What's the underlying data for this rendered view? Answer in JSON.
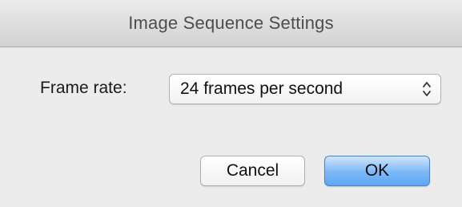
{
  "window": {
    "title": "Image Sequence Settings"
  },
  "frame_rate": {
    "label": "Frame rate:",
    "selected_value": "24 frames per second",
    "icon": "updown-chevron-icon"
  },
  "buttons": {
    "cancel_label": "Cancel",
    "ok_label": "OK"
  },
  "colors": {
    "default_button_accent": "#7bb8f7",
    "dialog_background": "#ececec"
  }
}
